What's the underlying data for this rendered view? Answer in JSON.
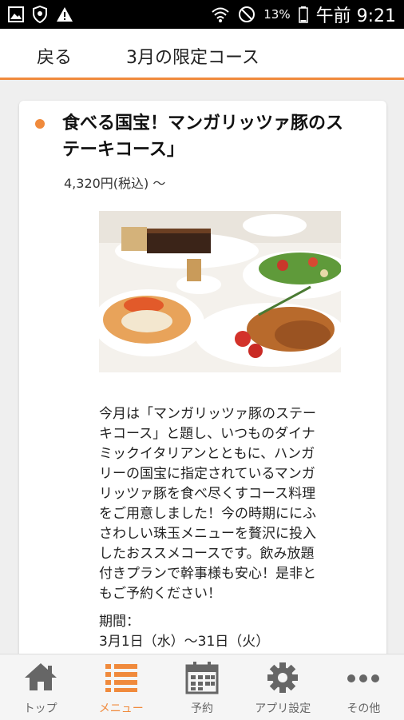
{
  "status_bar": {
    "icons_left": [
      "image-icon",
      "shield-icon",
      "warning-icon"
    ],
    "icons_right": [
      "wifi-icon",
      "blocked-icon"
    ],
    "battery_percent": "13%",
    "time": "午前 9:21"
  },
  "nav": {
    "back_label": "戻る",
    "title": "3月の限定コース"
  },
  "course": {
    "title_line1": "食べる国宝！マンガリッツァ豚のス",
    "title_line2": "テーキコース」",
    "price": "4,320円(税込) ～",
    "description_lines": [
      "今月は「マンガリッツァ豚のステー",
      "キコース」と題し、いつものダイナ",
      "ミックイタリアンとともに、ハンガ",
      "リーの国宝に指定されているマンガ",
      "リッツァ豚を食べ尽くすコース料理",
      "をご用意しました！今の時期ににふ",
      "さわしい珠玉メニューを贅沢に投入",
      "したおススメコースです。飲み放題",
      "付きプランで幹事様も安心！是非と",
      "もご予約ください！"
    ],
    "period_label": "期間：",
    "period_value": "3月1日（水）～31日（火）"
  },
  "tabs": [
    {
      "label": "トップ",
      "icon": "home-icon",
      "active": false
    },
    {
      "label": "メニュー",
      "icon": "menu-list-icon",
      "active": true
    },
    {
      "label": "予約",
      "icon": "calendar-icon",
      "active": false
    },
    {
      "label": "アプリ設定",
      "icon": "gear-icon",
      "active": false
    },
    {
      "label": "その他",
      "icon": "more-icon",
      "active": false
    }
  ],
  "colors": {
    "accent": "#f08a3c",
    "inactive_tab": "#666666"
  }
}
